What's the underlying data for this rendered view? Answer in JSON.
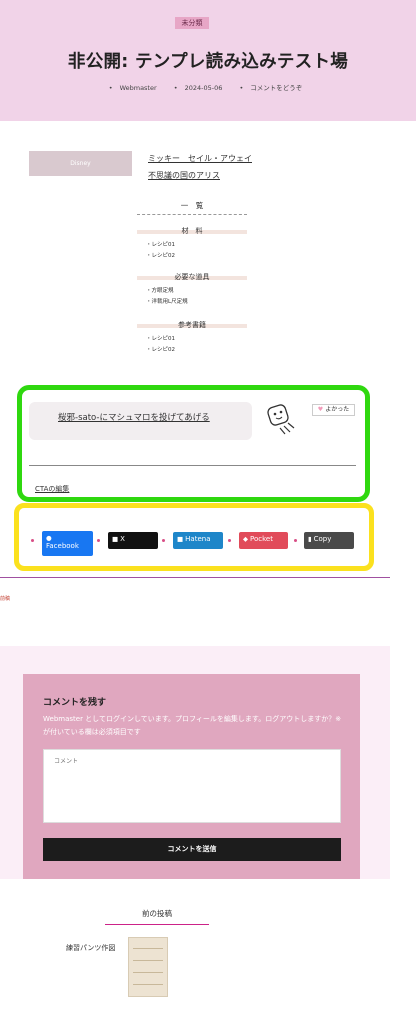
{
  "header": {
    "category": "未分類",
    "title": "非公開: テンプレ読み込みテスト場",
    "meta": {
      "author": "Webmaster",
      "date": "2024-05-06",
      "comments": "コメントをどうぞ"
    }
  },
  "links": {
    "thumb_label": "Disney",
    "link_a": "ミッキー　セイル・アウェイ",
    "link_b": "不思議の国のアリス"
  },
  "list": {
    "heading": "一　覧",
    "groups": [
      {
        "title": "材　料",
        "items": [
          "レシピ01",
          "レシピ02"
        ]
      },
      {
        "title": "必要な道具",
        "items": [
          "方眼定規",
          "洋裁用L尺定規"
        ]
      },
      {
        "title": "参考書籍",
        "items": [
          "レシピ01",
          "レシピ02"
        ]
      }
    ]
  },
  "marshmallow": {
    "text": "桜邪-sato-にマシュマロを投げてあげる",
    "yokatta": "よかった",
    "cta_edit": "CTAの編集"
  },
  "share": {
    "facebook": "Facebook",
    "x": "X",
    "hatena": "Hatena",
    "pocket": "Pocket",
    "copy": "Copy"
  },
  "mini_label": "前稿",
  "comment": {
    "title": "コメントを残す",
    "note": "Webmaster としてログインしています。プロフィールを編集します。ログアウトしますか？※ が付いている欄は必須項目です",
    "placeholder": "コメント",
    "submit": "コメントを送信"
  },
  "previous": {
    "heading": "前の投稿",
    "title": "練習パンツ作図"
  },
  "colors": {
    "hero_bg": "#f1d3e8",
    "badge": "#e7a6c6",
    "highlight_green": "#2fd80f",
    "highlight_yellow": "#fbe11e",
    "comment_panel": "#e0a7bf",
    "submit": "#1c1c1c"
  }
}
